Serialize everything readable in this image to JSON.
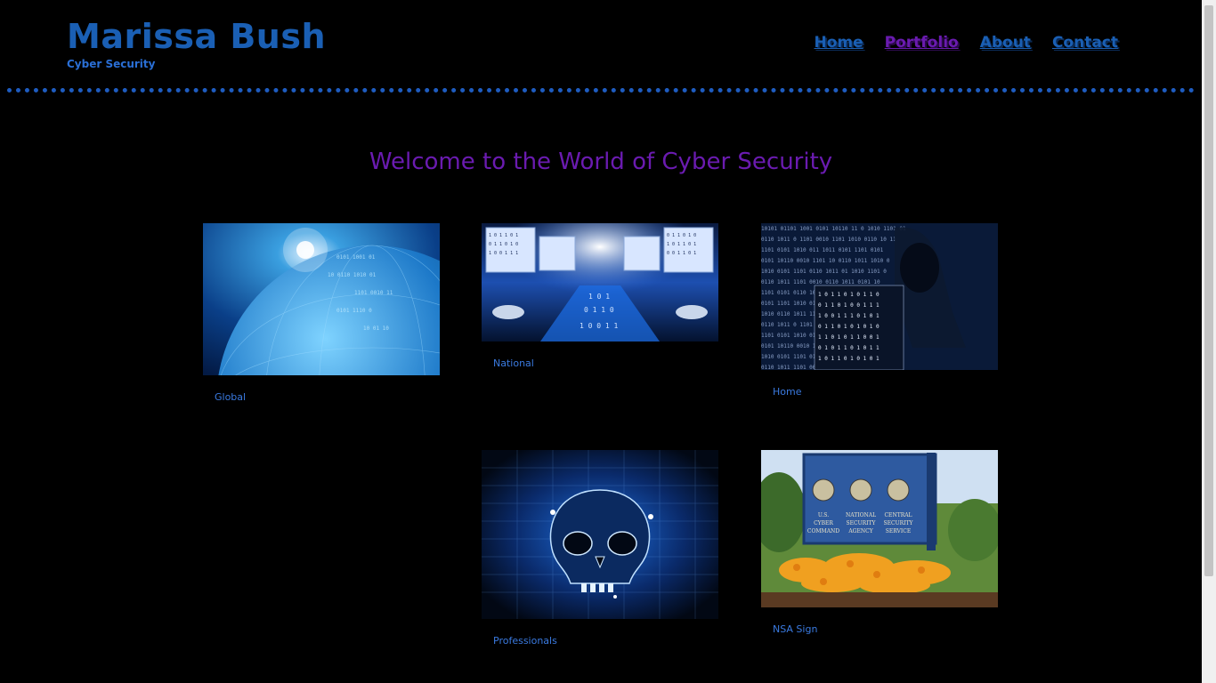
{
  "header": {
    "title": "Marissa Bush",
    "subtitle": "Cyber Security"
  },
  "nav": {
    "items": [
      {
        "label": "Home",
        "active": false
      },
      {
        "label": "Portfolio",
        "active": true
      },
      {
        "label": "About",
        "active": false
      },
      {
        "label": "Contact",
        "active": false
      }
    ]
  },
  "main": {
    "headline": "Welcome to the World of Cyber Security"
  },
  "gallery": [
    {
      "caption": "Global",
      "image": "glowing-globe-icon"
    },
    {
      "caption": "National",
      "image": "binary-monitors-icon"
    },
    {
      "caption": "Home",
      "image": "hooded-hacker-icon"
    },
    {
      "caption": "Professionals",
      "image": "digital-skull-icon"
    },
    {
      "caption": "NSA Sign",
      "image": "nsa-sign-icon"
    }
  ],
  "colors": {
    "background": "#000000",
    "brand": "#1a5fb4",
    "accent": "#6a1bb0",
    "caption": "#3a7ae0"
  }
}
